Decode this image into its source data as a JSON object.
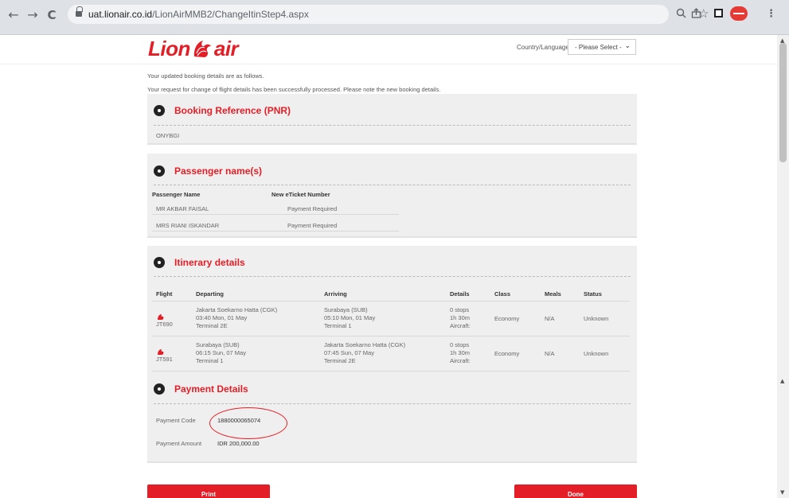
{
  "browser": {
    "url_host": "uat.lionair.co.id",
    "url_path": "/LionAirMMB2/ChangeItinStep4.aspx",
    "icons": [
      "back-arrow-icon",
      "forward-arrow-icon",
      "reload-icon",
      "lock-icon",
      "zoom-icon",
      "share-icon",
      "star-icon",
      "sidebar-icon",
      "profile-icon",
      "menu-icon"
    ]
  },
  "header": {
    "logo_left": "Lion",
    "logo_right": "air",
    "country_label": "Country/Language",
    "country_select": "- Please Select -"
  },
  "intro": {
    "line1": "Your updated booking details are as follows.",
    "line2": "Your request for change of flight details has been successfully processed. Please note the new booking details."
  },
  "pnr": {
    "title": "Booking Reference (PNR)",
    "value": "ONYBGI"
  },
  "passengers": {
    "title": "Passenger name(s)",
    "col_name": "Passenger Name",
    "col_ticket": "New eTicket Number",
    "rows": [
      {
        "name": "MR AKBAR FAISAL",
        "ticket": "Payment Required"
      },
      {
        "name": "MRS RIANI ISKANDAR",
        "ticket": "Payment Required"
      }
    ]
  },
  "itinerary": {
    "title": "Itinerary details",
    "columns": [
      "Flight",
      "Departing",
      "Arriving",
      "Details",
      "Class",
      "Meals",
      "Status"
    ],
    "flights": [
      {
        "flight": "JT690",
        "dep_place": "Jakarta Soekarno Hatta (CGK)",
        "dep_time": "03:40 Mon, 01 May",
        "dep_terminal": "Terminal 2E",
        "arr_place": "Surabaya (SUB)",
        "arr_time": "05:10 Mon, 01 May",
        "arr_terminal": "Terminal 1",
        "stops": "0 stops",
        "duration": "1h 30m",
        "aircraft": "Aircraft:",
        "class": "Economy",
        "meals": "N/A",
        "status": "Unknown"
      },
      {
        "flight": "JT591",
        "dep_place": "Surabaya (SUB)",
        "dep_time": "06:15 Sun, 07 May",
        "dep_terminal": "Terminal 1",
        "arr_place": "Jakarta Soekarno Hatta (CGK)",
        "arr_time": "07:45 Sun, 07 May",
        "arr_terminal": "Terminal 2E",
        "stops": "0 stops",
        "duration": "1h 30m",
        "aircraft": "Aircraft:",
        "class": "Economy",
        "meals": "N/A",
        "status": "Unknown"
      }
    ]
  },
  "payment": {
    "title": "Payment Details",
    "code_label": "Payment Code",
    "code_value": "1880000065074",
    "amount_label": "Payment Amount",
    "amount_value": "IDR 200,000.00"
  },
  "actions": {
    "print": "Print",
    "done": "Done"
  },
  "colors": {
    "brand_red": "#e41e26",
    "card_bg": "#efefef"
  }
}
